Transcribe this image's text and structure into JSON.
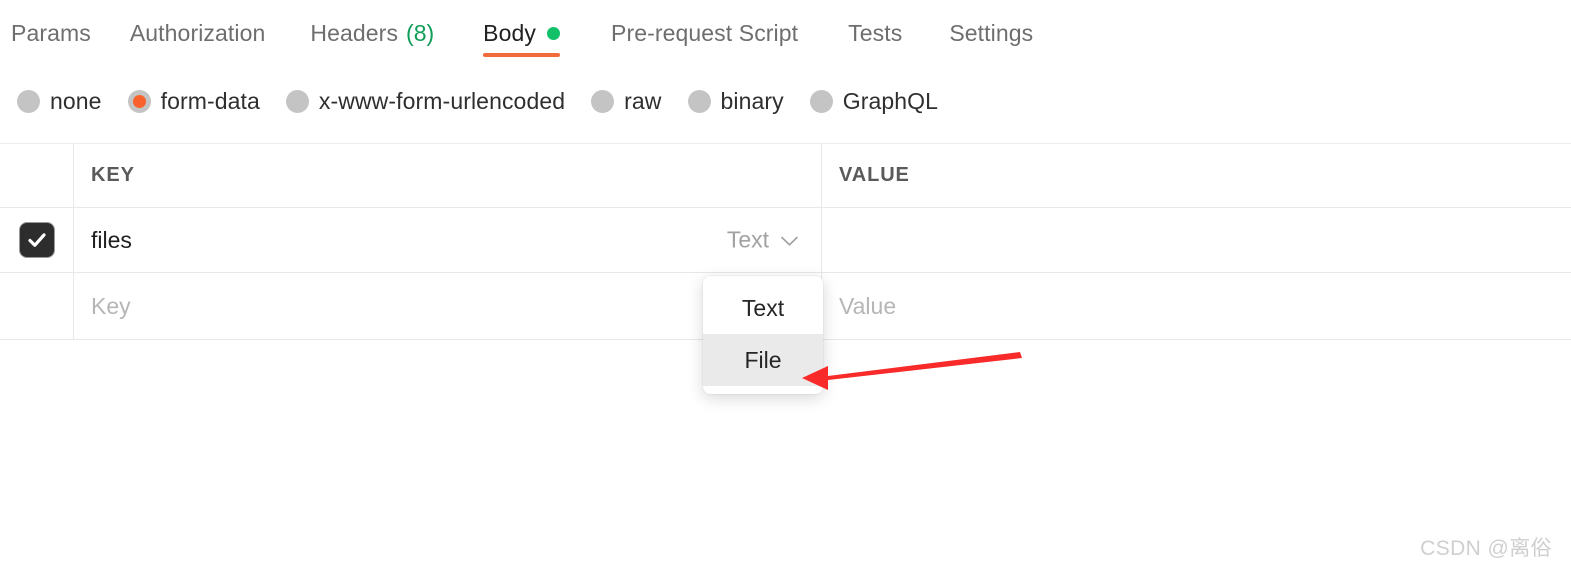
{
  "tabs": [
    {
      "label": "Params",
      "active": false
    },
    {
      "label": "Authorization",
      "active": false
    },
    {
      "label": "Headers",
      "count": "(8)",
      "active": false
    },
    {
      "label": "Body",
      "active": true,
      "indicator": "green-dot"
    },
    {
      "label": "Pre-request Script",
      "active": false
    },
    {
      "label": "Tests",
      "active": false
    },
    {
      "label": "Settings",
      "active": false
    }
  ],
  "body_types": [
    {
      "label": "none",
      "selected": false
    },
    {
      "label": "form-data",
      "selected": true
    },
    {
      "label": "x-www-form-urlencoded",
      "selected": false
    },
    {
      "label": "raw",
      "selected": false
    },
    {
      "label": "binary",
      "selected": false
    },
    {
      "label": "GraphQL",
      "selected": false
    }
  ],
  "table": {
    "headers": {
      "key": "KEY",
      "value": "VALUE"
    },
    "rows": [
      {
        "checked": true,
        "key": "files",
        "type": "Text",
        "value": ""
      },
      {
        "checked": false,
        "key_placeholder": "Key",
        "value_placeholder": "Value"
      }
    ]
  },
  "dropdown": {
    "open": true,
    "items": [
      {
        "label": "Text",
        "hovered": false
      },
      {
        "label": "File",
        "hovered": true
      }
    ]
  },
  "annotation": {
    "type": "arrow",
    "color": "#f82a2a",
    "points_to": "File"
  },
  "watermark": "CSDN @离俗",
  "colors": {
    "accent_orange": "#f26b3a",
    "radio_selected": "#f9622c",
    "green_dot": "#13c06a",
    "count_green": "#0f9d58",
    "arrow_red": "#f82a2a",
    "checkbox_dark": "#2d2d2d"
  }
}
